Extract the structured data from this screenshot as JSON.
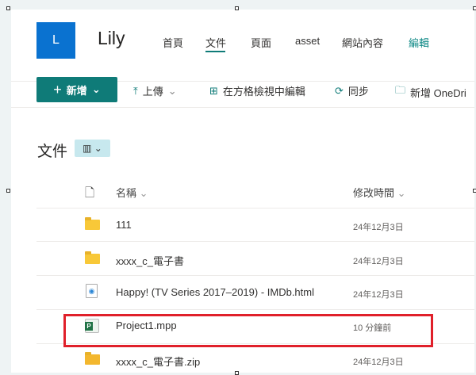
{
  "site": {
    "logo_letter": "L",
    "title": "Lily"
  },
  "nav": [
    {
      "label": "首頁"
    },
    {
      "label": "文件"
    },
    {
      "label": "頁面"
    },
    {
      "label": "asset"
    },
    {
      "label": "網站內容"
    },
    {
      "label": "編輯"
    }
  ],
  "toolbar": {
    "new": "新增",
    "upload": "上傳",
    "grid_edit": "在方格檢視中編輯",
    "sync": "同步",
    "add_shortcut": "新增 OneDri"
  },
  "library": {
    "title": "文件"
  },
  "columns": {
    "name": "名稱",
    "modified": "修改時間"
  },
  "files": [
    {
      "name": "111",
      "modified": "24年12月3日",
      "type": "folder"
    },
    {
      "name": "xxxx_c_電子書",
      "modified": "24年12月3日",
      "type": "folder"
    },
    {
      "name": "Happy! (TV Series 2017–2019) - IMDb.html",
      "modified": "24年12月3日",
      "type": "html"
    },
    {
      "name": "Project1.mpp",
      "modified": "10 分鐘前",
      "type": "project"
    },
    {
      "name": "xxxx_c_電子書.zip",
      "modified": "24年12月3日",
      "type": "zip"
    }
  ],
  "colors": {
    "accent": "#0f7b78",
    "logo": "#0a72d0",
    "highlight": "#e0202a"
  }
}
